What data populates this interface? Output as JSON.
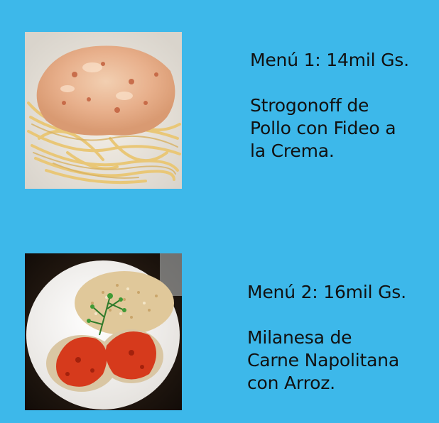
{
  "menus": [
    {
      "price": "Menú 1: 14mil Gs.",
      "description_lines": [
        "Strogonoff de",
        "Pollo con Fideo a",
        "la Crema."
      ],
      "image_icon": "spaghetti-with-cream-sauce"
    },
    {
      "price": "Menú 2: 16mil Gs.",
      "description_lines": [
        "Milanesa de",
        "Carne Napolitana",
        "con Arroz."
      ],
      "image_icon": "milanesa-napolitana-with-rice"
    }
  ],
  "colors": {
    "background": "#3db8ea",
    "text": "#111111"
  }
}
